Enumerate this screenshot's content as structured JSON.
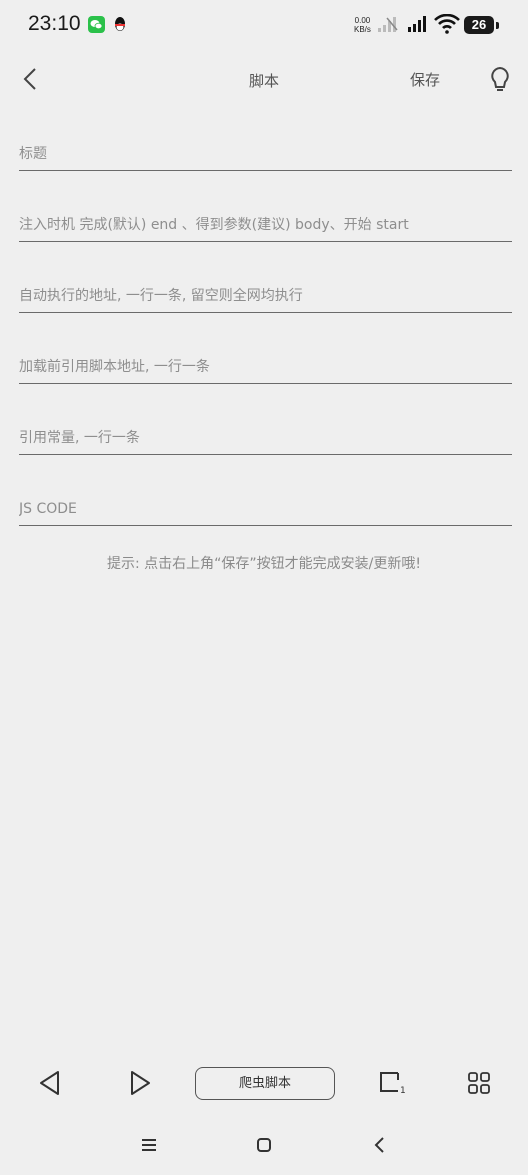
{
  "status_bar": {
    "time": "23:10",
    "net_speed_value": "0.00",
    "net_speed_unit": "KB/s",
    "battery": "26"
  },
  "toolbar": {
    "title": "脚本",
    "save_label": "保存"
  },
  "form": {
    "title_placeholder": "标题",
    "inject_timing_placeholder": "注入时机 完成(默认) end 、得到参数(建议) body、开始 start",
    "auto_run_urls_placeholder": "自动执行的地址, 一行一条, 留空则全网均执行",
    "preload_scripts_placeholder": "加载前引用脚本地址, 一行一条",
    "constants_placeholder": "引用常量, 一行一条",
    "js_code_placeholder": "JS CODE"
  },
  "hint": "提示: 点击右上角“保存”按钮才能完成安装/更新哦!",
  "bottom_bar": {
    "center_label": "爬虫脚本",
    "tab_count": "1"
  }
}
